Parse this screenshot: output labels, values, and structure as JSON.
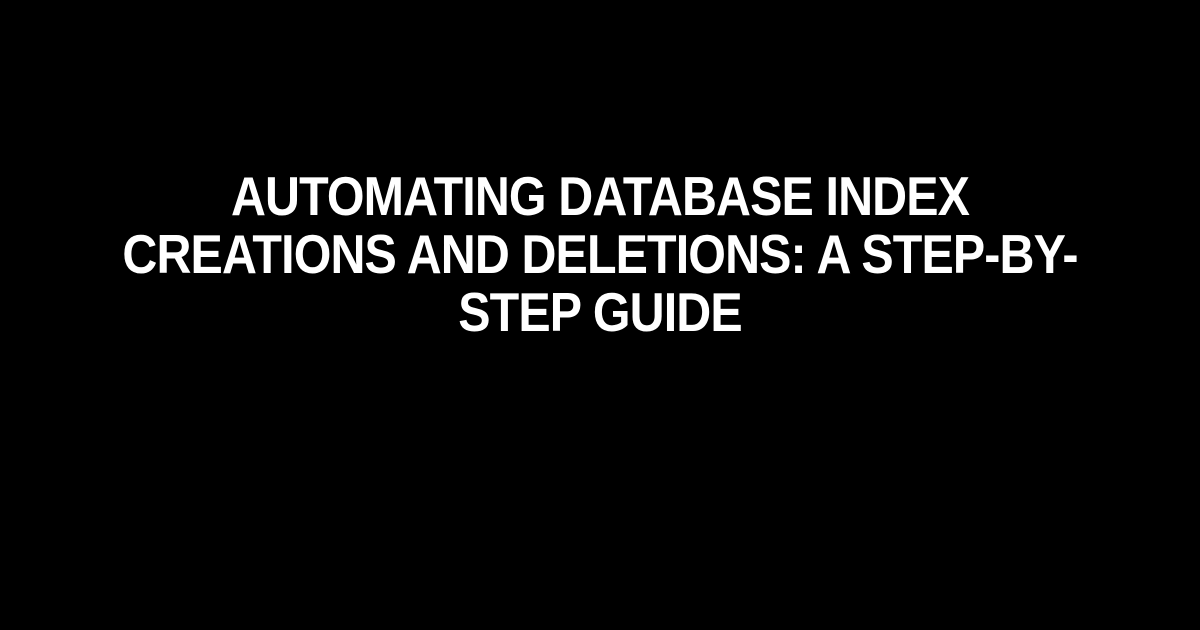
{
  "title": "Automating Database Index Creations and Deletions: A Step-by-Step Guide"
}
